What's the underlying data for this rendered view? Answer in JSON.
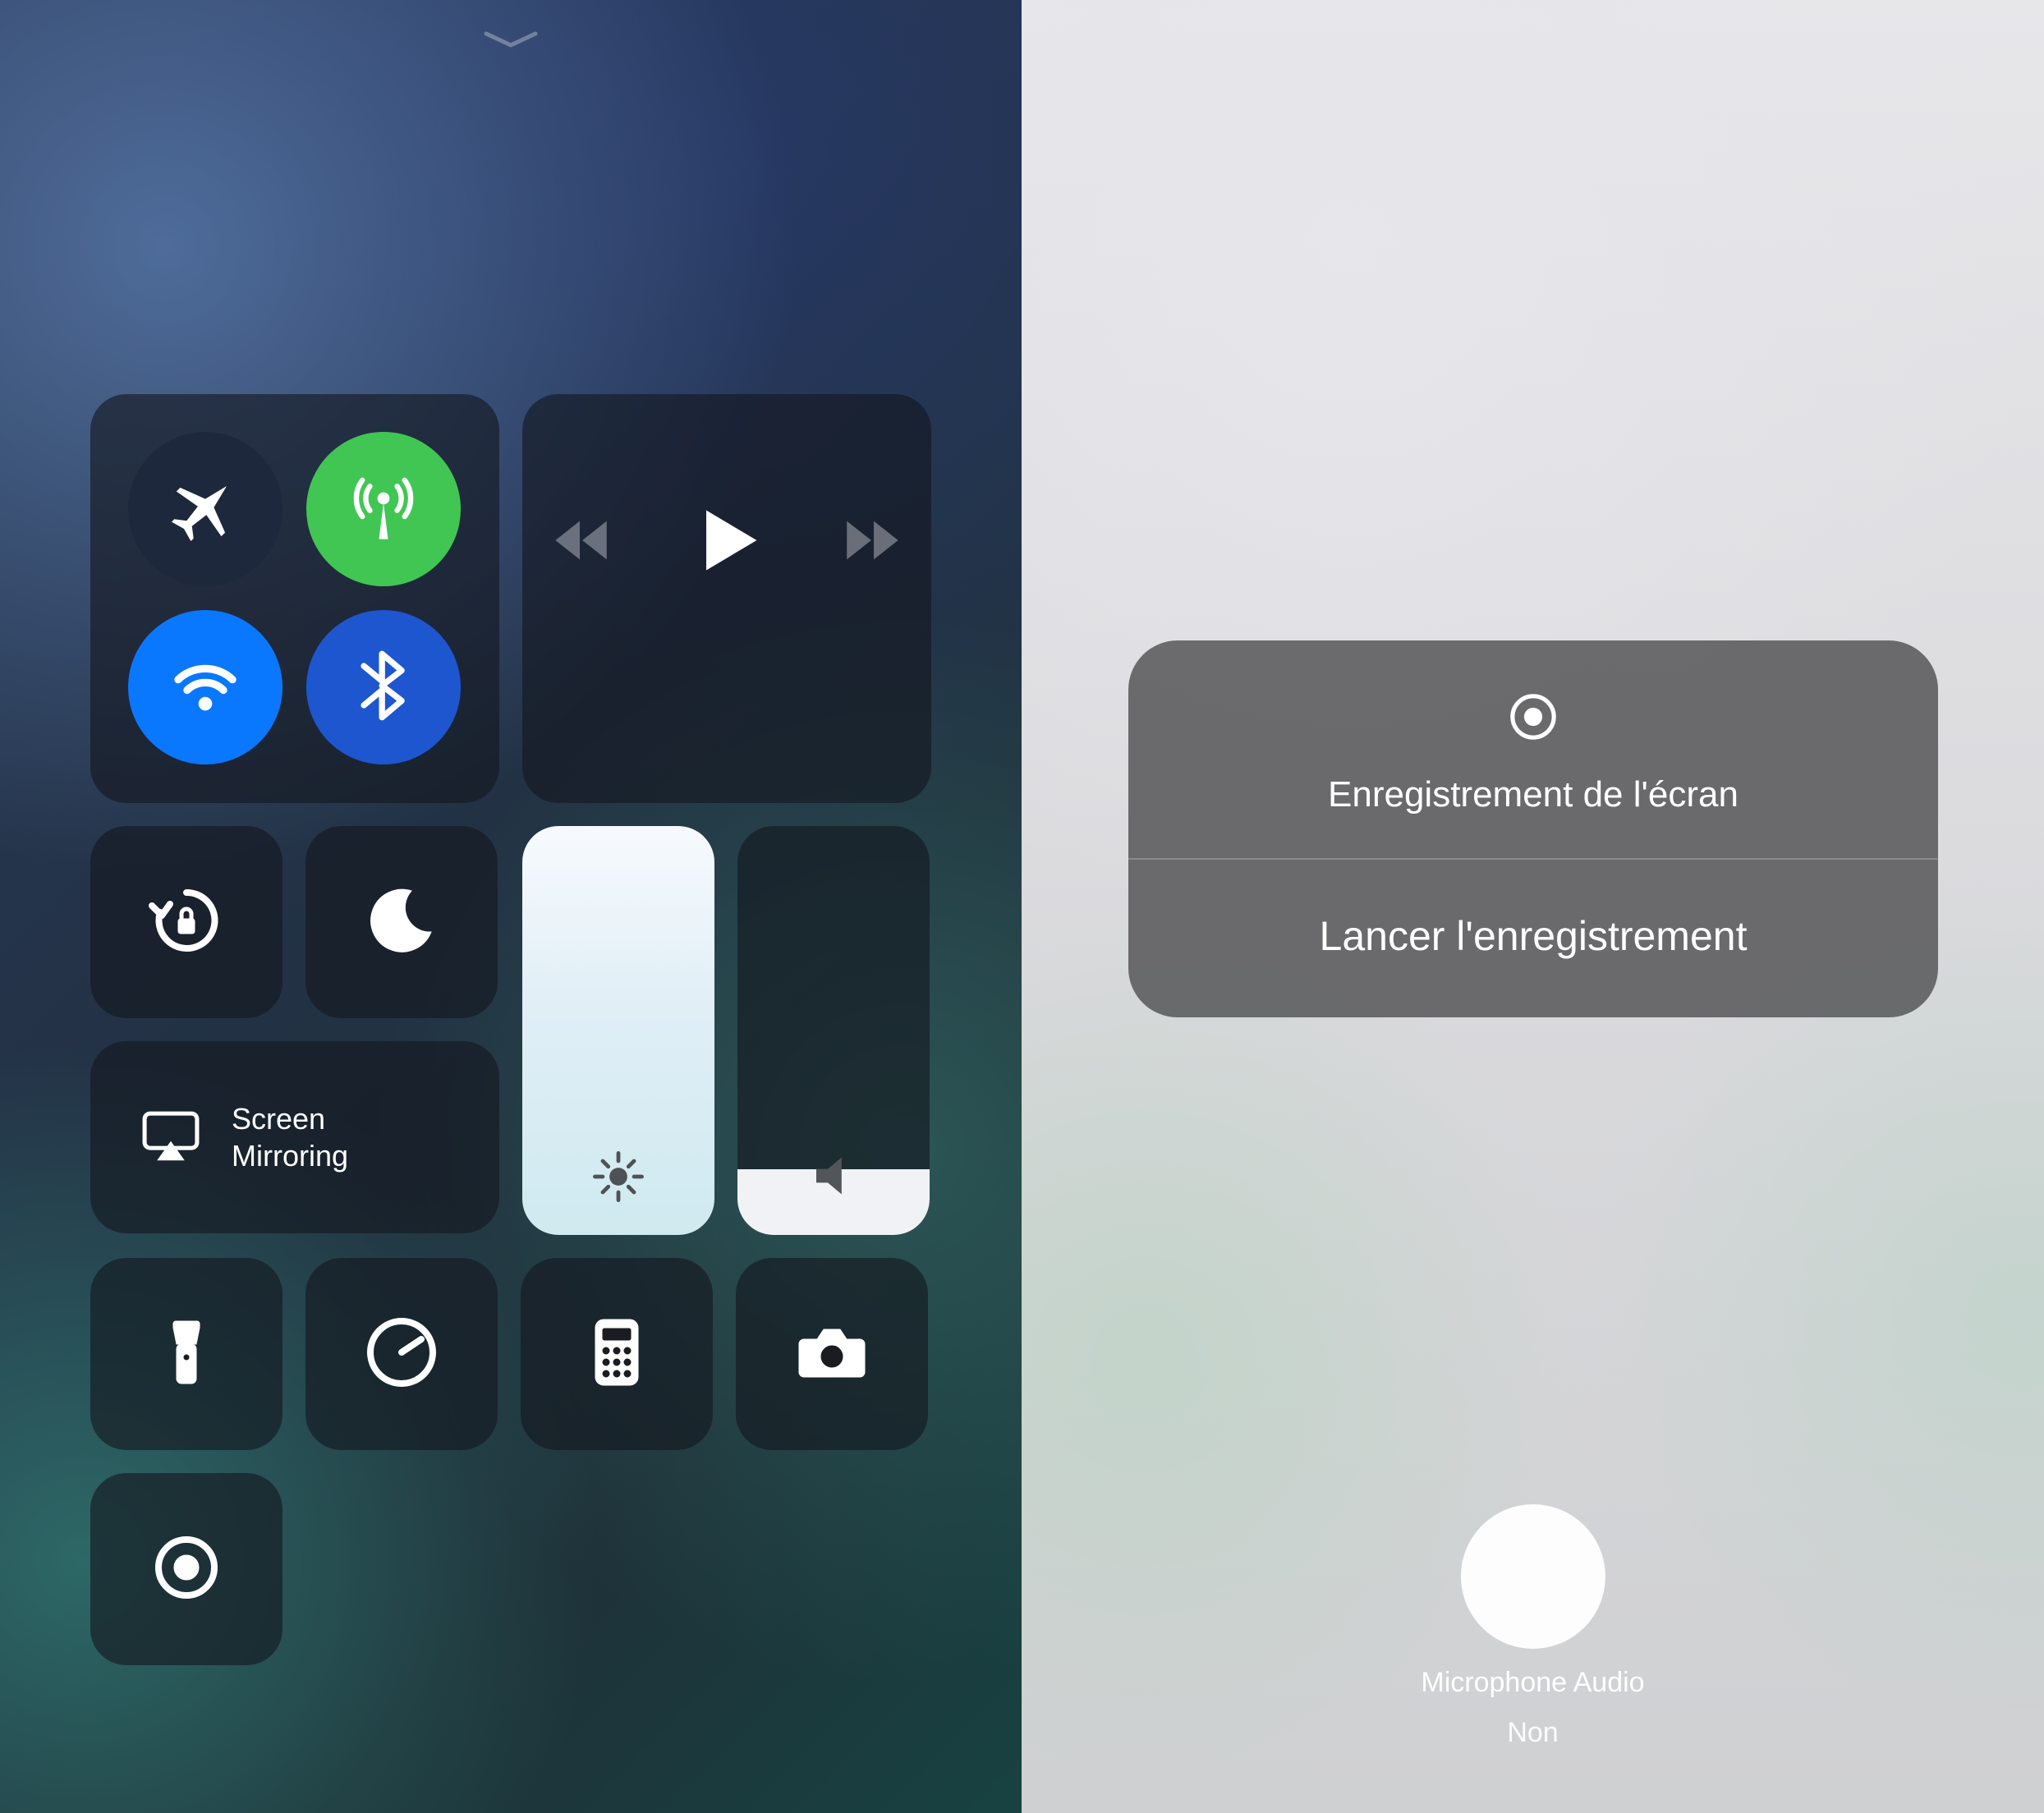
{
  "left": {
    "screen_mirroring": {
      "line1": "Screen",
      "line2": "Mirroring"
    },
    "brightness_percent": 100,
    "volume_percent": 16
  },
  "right": {
    "popup_title": "Enregistrement de l'écran",
    "popup_action": "Lancer l'enregistrement",
    "mic_label": "Microphone Audio",
    "mic_value": "Non"
  }
}
